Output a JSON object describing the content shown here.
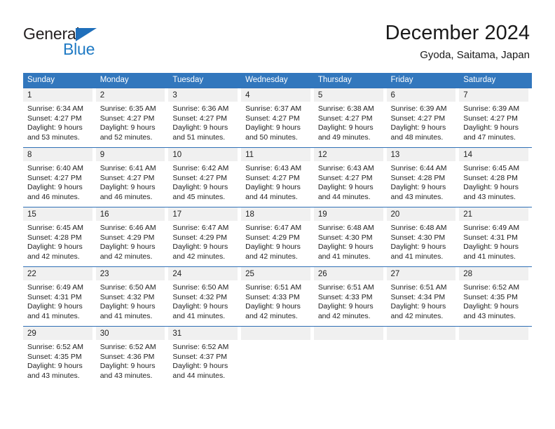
{
  "brand": {
    "name_top": "General",
    "name_bottom": "Blue",
    "colors": {
      "general_text": "#231f20",
      "blue_text": "#1f7ac4",
      "triangle": "#1f6fbb"
    }
  },
  "header": {
    "title": "December 2024",
    "location": "Gyoda, Saitama, Japan"
  },
  "theme": {
    "header_row_bg": "#3277bd",
    "header_row_text": "#ffffff",
    "week_divider": "#2f6fb5",
    "daynum_band_bg": "#f0f0f0",
    "body_text": "#222222"
  },
  "weekdays": [
    "Sunday",
    "Monday",
    "Tuesday",
    "Wednesday",
    "Thursday",
    "Friday",
    "Saturday"
  ],
  "weeks": [
    [
      {
        "day": "1",
        "sunrise": "Sunrise: 6:34 AM",
        "sunset": "Sunset: 4:27 PM",
        "daylight": "Daylight: 9 hours and 53 minutes."
      },
      {
        "day": "2",
        "sunrise": "Sunrise: 6:35 AM",
        "sunset": "Sunset: 4:27 PM",
        "daylight": "Daylight: 9 hours and 52 minutes."
      },
      {
        "day": "3",
        "sunrise": "Sunrise: 6:36 AM",
        "sunset": "Sunset: 4:27 PM",
        "daylight": "Daylight: 9 hours and 51 minutes."
      },
      {
        "day": "4",
        "sunrise": "Sunrise: 6:37 AM",
        "sunset": "Sunset: 4:27 PM",
        "daylight": "Daylight: 9 hours and 50 minutes."
      },
      {
        "day": "5",
        "sunrise": "Sunrise: 6:38 AM",
        "sunset": "Sunset: 4:27 PM",
        "daylight": "Daylight: 9 hours and 49 minutes."
      },
      {
        "day": "6",
        "sunrise": "Sunrise: 6:39 AM",
        "sunset": "Sunset: 4:27 PM",
        "daylight": "Daylight: 9 hours and 48 minutes."
      },
      {
        "day": "7",
        "sunrise": "Sunrise: 6:39 AM",
        "sunset": "Sunset: 4:27 PM",
        "daylight": "Daylight: 9 hours and 47 minutes."
      }
    ],
    [
      {
        "day": "8",
        "sunrise": "Sunrise: 6:40 AM",
        "sunset": "Sunset: 4:27 PM",
        "daylight": "Daylight: 9 hours and 46 minutes."
      },
      {
        "day": "9",
        "sunrise": "Sunrise: 6:41 AM",
        "sunset": "Sunset: 4:27 PM",
        "daylight": "Daylight: 9 hours and 46 minutes."
      },
      {
        "day": "10",
        "sunrise": "Sunrise: 6:42 AM",
        "sunset": "Sunset: 4:27 PM",
        "daylight": "Daylight: 9 hours and 45 minutes."
      },
      {
        "day": "11",
        "sunrise": "Sunrise: 6:43 AM",
        "sunset": "Sunset: 4:27 PM",
        "daylight": "Daylight: 9 hours and 44 minutes."
      },
      {
        "day": "12",
        "sunrise": "Sunrise: 6:43 AM",
        "sunset": "Sunset: 4:27 PM",
        "daylight": "Daylight: 9 hours and 44 minutes."
      },
      {
        "day": "13",
        "sunrise": "Sunrise: 6:44 AM",
        "sunset": "Sunset: 4:28 PM",
        "daylight": "Daylight: 9 hours and 43 minutes."
      },
      {
        "day": "14",
        "sunrise": "Sunrise: 6:45 AM",
        "sunset": "Sunset: 4:28 PM",
        "daylight": "Daylight: 9 hours and 43 minutes."
      }
    ],
    [
      {
        "day": "15",
        "sunrise": "Sunrise: 6:45 AM",
        "sunset": "Sunset: 4:28 PM",
        "daylight": "Daylight: 9 hours and 42 minutes."
      },
      {
        "day": "16",
        "sunrise": "Sunrise: 6:46 AM",
        "sunset": "Sunset: 4:29 PM",
        "daylight": "Daylight: 9 hours and 42 minutes."
      },
      {
        "day": "17",
        "sunrise": "Sunrise: 6:47 AM",
        "sunset": "Sunset: 4:29 PM",
        "daylight": "Daylight: 9 hours and 42 minutes."
      },
      {
        "day": "18",
        "sunrise": "Sunrise: 6:47 AM",
        "sunset": "Sunset: 4:29 PM",
        "daylight": "Daylight: 9 hours and 42 minutes."
      },
      {
        "day": "19",
        "sunrise": "Sunrise: 6:48 AM",
        "sunset": "Sunset: 4:30 PM",
        "daylight": "Daylight: 9 hours and 41 minutes."
      },
      {
        "day": "20",
        "sunrise": "Sunrise: 6:48 AM",
        "sunset": "Sunset: 4:30 PM",
        "daylight": "Daylight: 9 hours and 41 minutes."
      },
      {
        "day": "21",
        "sunrise": "Sunrise: 6:49 AM",
        "sunset": "Sunset: 4:31 PM",
        "daylight": "Daylight: 9 hours and 41 minutes."
      }
    ],
    [
      {
        "day": "22",
        "sunrise": "Sunrise: 6:49 AM",
        "sunset": "Sunset: 4:31 PM",
        "daylight": "Daylight: 9 hours and 41 minutes."
      },
      {
        "day": "23",
        "sunrise": "Sunrise: 6:50 AM",
        "sunset": "Sunset: 4:32 PM",
        "daylight": "Daylight: 9 hours and 41 minutes."
      },
      {
        "day": "24",
        "sunrise": "Sunrise: 6:50 AM",
        "sunset": "Sunset: 4:32 PM",
        "daylight": "Daylight: 9 hours and 41 minutes."
      },
      {
        "day": "25",
        "sunrise": "Sunrise: 6:51 AM",
        "sunset": "Sunset: 4:33 PM",
        "daylight": "Daylight: 9 hours and 42 minutes."
      },
      {
        "day": "26",
        "sunrise": "Sunrise: 6:51 AM",
        "sunset": "Sunset: 4:33 PM",
        "daylight": "Daylight: 9 hours and 42 minutes."
      },
      {
        "day": "27",
        "sunrise": "Sunrise: 6:51 AM",
        "sunset": "Sunset: 4:34 PM",
        "daylight": "Daylight: 9 hours and 42 minutes."
      },
      {
        "day": "28",
        "sunrise": "Sunrise: 6:52 AM",
        "sunset": "Sunset: 4:35 PM",
        "daylight": "Daylight: 9 hours and 43 minutes."
      }
    ],
    [
      {
        "day": "29",
        "sunrise": "Sunrise: 6:52 AM",
        "sunset": "Sunset: 4:35 PM",
        "daylight": "Daylight: 9 hours and 43 minutes."
      },
      {
        "day": "30",
        "sunrise": "Sunrise: 6:52 AM",
        "sunset": "Sunset: 4:36 PM",
        "daylight": "Daylight: 9 hours and 43 minutes."
      },
      {
        "day": "31",
        "sunrise": "Sunrise: 6:52 AM",
        "sunset": "Sunset: 4:37 PM",
        "daylight": "Daylight: 9 hours and 44 minutes."
      },
      {
        "day": "",
        "sunrise": "",
        "sunset": "",
        "daylight": ""
      },
      {
        "day": "",
        "sunrise": "",
        "sunset": "",
        "daylight": ""
      },
      {
        "day": "",
        "sunrise": "",
        "sunset": "",
        "daylight": ""
      },
      {
        "day": "",
        "sunrise": "",
        "sunset": "",
        "daylight": ""
      }
    ]
  ]
}
